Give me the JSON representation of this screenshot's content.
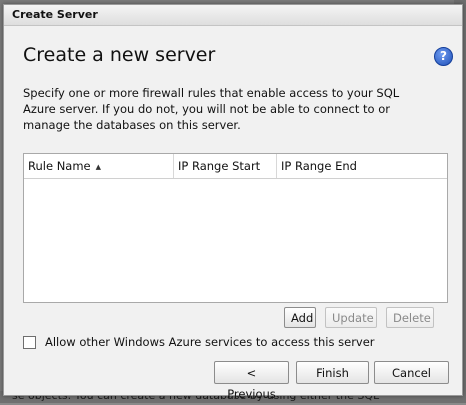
{
  "background": {
    "bottom_text": "se objects.  You can create a new database by using either the SQL"
  },
  "dialog": {
    "title": "Create Server",
    "heading": "Create a new server",
    "help_glyph": "?",
    "description": "Specify one or more firewall rules that enable access to your SQL Azure server. If you do not, you will not be able to connect to or manage the databases on this server."
  },
  "grid": {
    "columns": [
      "Rule Name",
      "IP Range Start",
      "IP Range End"
    ],
    "sort_glyph": "▲",
    "rows": []
  },
  "grid_buttons": {
    "add": "Add",
    "update": "Update",
    "delete": "Delete"
  },
  "checkbox": {
    "label": "Allow other Windows Azure services to access this server",
    "checked": false
  },
  "footer": {
    "previous": "< Previous",
    "finish": "Finish",
    "cancel": "Cancel"
  },
  "colors": {
    "help_icon": "#1e4fb8",
    "dialog_bg": "#f1f1f1"
  }
}
